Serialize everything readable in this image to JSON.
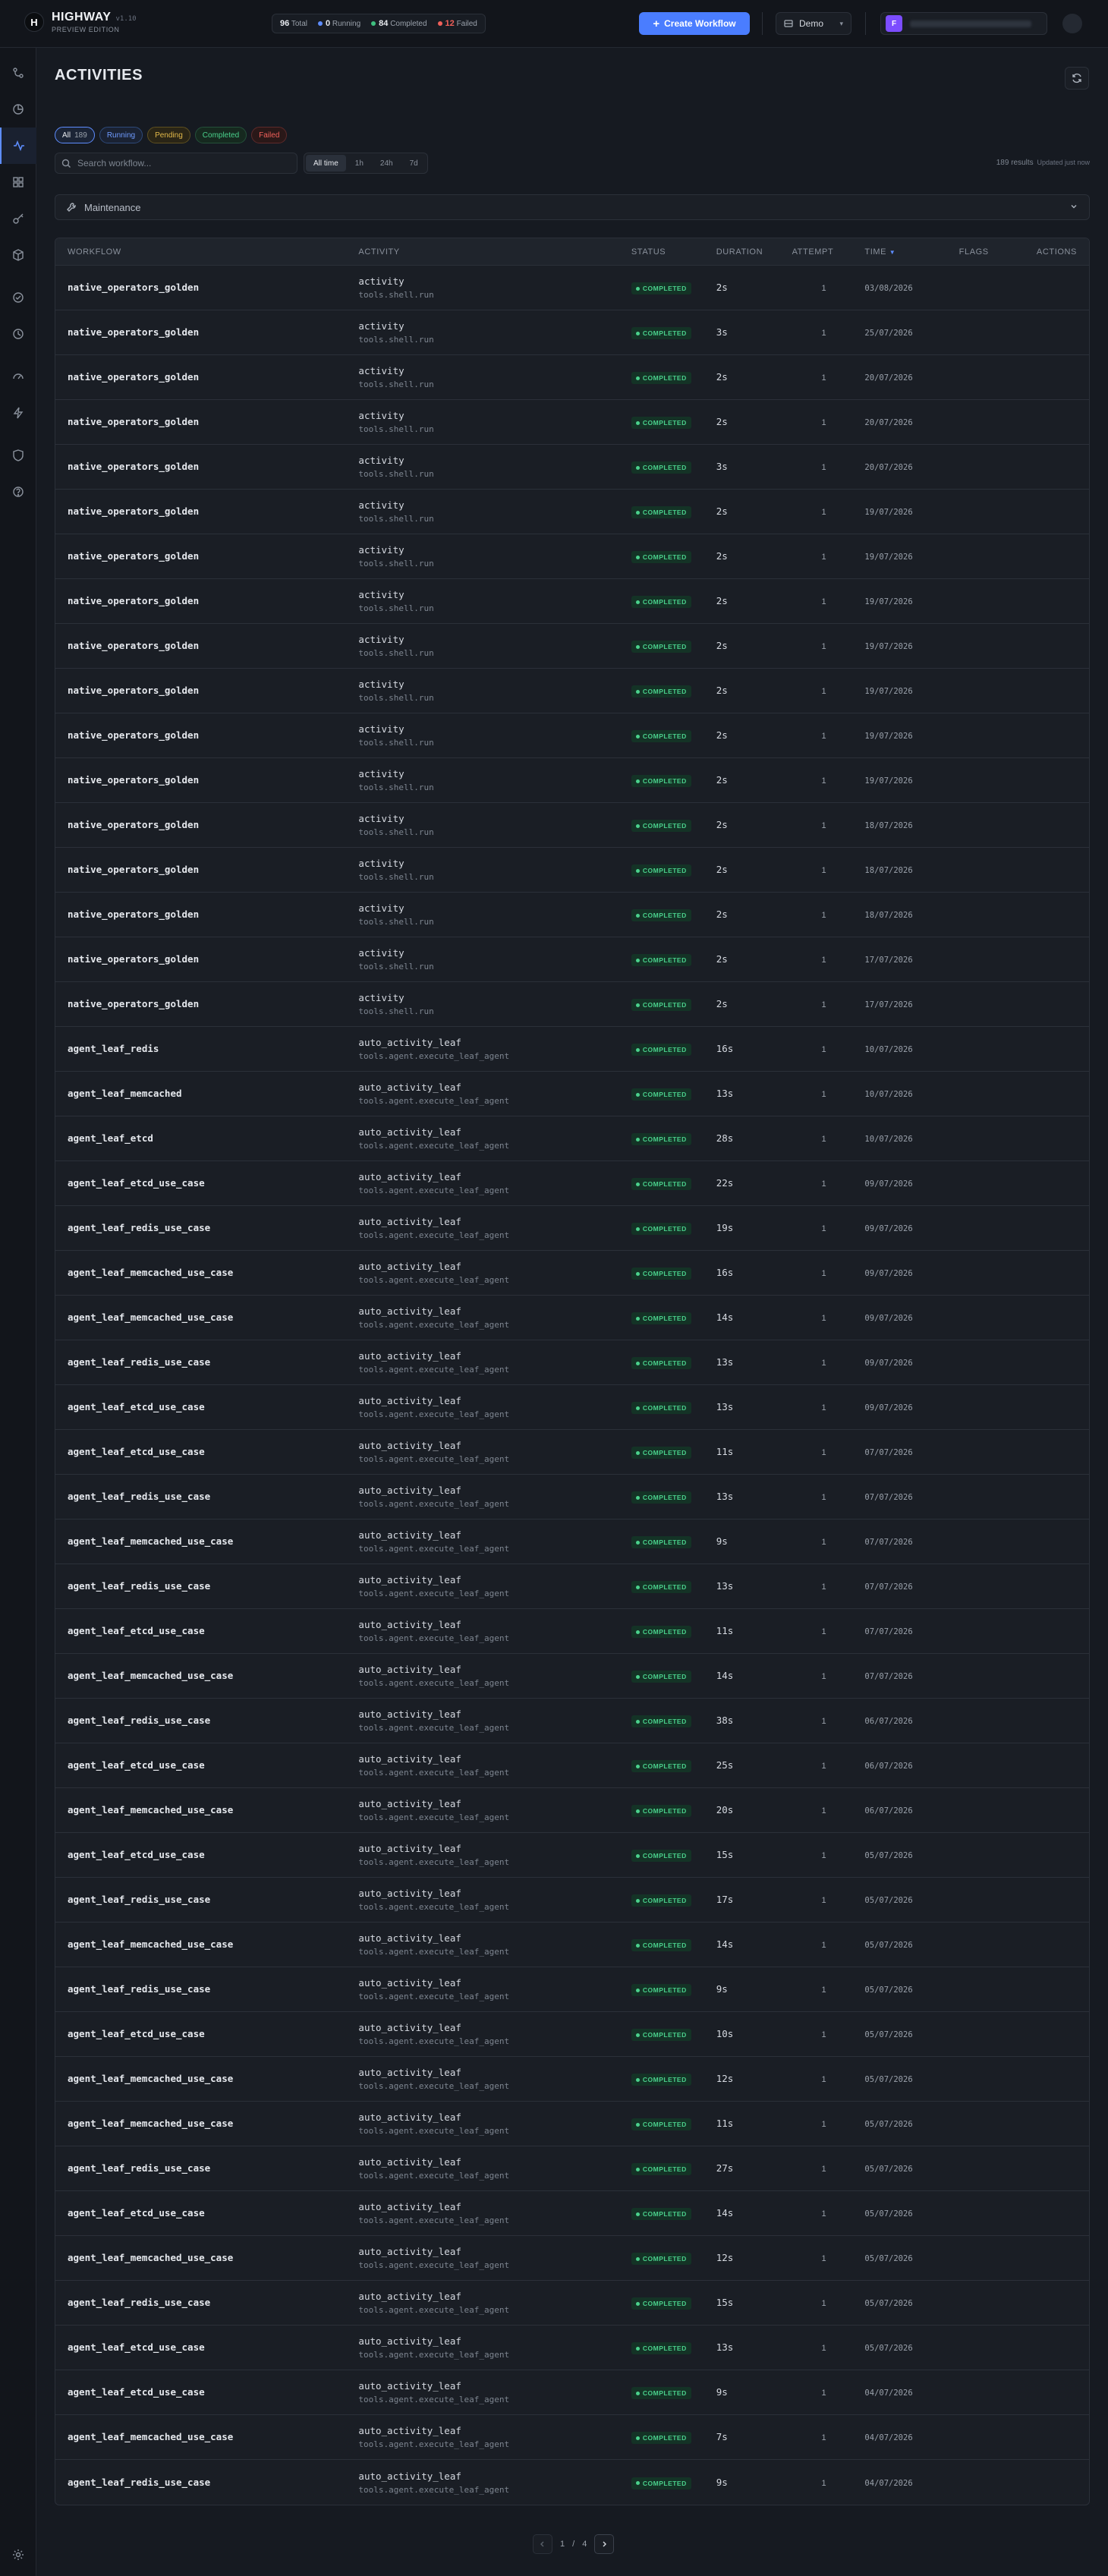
{
  "brand": {
    "logo": "H",
    "name": "HIGHWAY",
    "version": "v1.10",
    "subtitle": "PREVIEW EDITION"
  },
  "stats": {
    "total_value": "96",
    "total_label": "Total",
    "running_value": "0",
    "running_label": "Running",
    "completed_value": "84",
    "completed_label": "Completed",
    "failed_value": "12",
    "failed_label": "Failed",
    "colors": {
      "running": "#5e8dff",
      "completed": "#3fbf7f",
      "failed": "#f0605a"
    }
  },
  "header": {
    "create_label": "Create Workflow",
    "demo_label": "Demo",
    "avatar_letter": "F"
  },
  "page": {
    "title": "ACTIVITIES"
  },
  "filters": {
    "all_label": "All",
    "all_count": "189",
    "running_label": "Running",
    "pending_label": "Pending",
    "completed_label": "Completed",
    "failed_label": "Failed"
  },
  "search": {
    "placeholder": "Search workflow..."
  },
  "range": {
    "all_time": "All time",
    "h1": "1h",
    "h24": "24h",
    "d7": "7d"
  },
  "results": {
    "count_text": "189 results",
    "updated_text": "Updated just now"
  },
  "maintenance": {
    "label": "Maintenance"
  },
  "table": {
    "columns": {
      "workflow": "WORKFLOW",
      "activity": "ACTIVITY",
      "status": "STATUS",
      "duration": "DURATION",
      "attempt": "ATTEMPT",
      "time": "TIME",
      "flags": "FLAGS",
      "actions": "ACTIONS"
    },
    "sort_indicator": "▼",
    "rows": [
      {
        "workflow": "native_operators_golden",
        "activity": "activity",
        "path": "tools.shell.run",
        "status": "COMPLETED",
        "duration": "2s",
        "attempt": "1",
        "time": "03/08/2026"
      },
      {
        "workflow": "native_operators_golden",
        "activity": "activity",
        "path": "tools.shell.run",
        "status": "COMPLETED",
        "duration": "3s",
        "attempt": "1",
        "time": "25/07/2026"
      },
      {
        "workflow": "native_operators_golden",
        "activity": "activity",
        "path": "tools.shell.run",
        "status": "COMPLETED",
        "duration": "2s",
        "attempt": "1",
        "time": "20/07/2026"
      },
      {
        "workflow": "native_operators_golden",
        "activity": "activity",
        "path": "tools.shell.run",
        "status": "COMPLETED",
        "duration": "2s",
        "attempt": "1",
        "time": "20/07/2026"
      },
      {
        "workflow": "native_operators_golden",
        "activity": "activity",
        "path": "tools.shell.run",
        "status": "COMPLETED",
        "duration": "3s",
        "attempt": "1",
        "time": "20/07/2026"
      },
      {
        "workflow": "native_operators_golden",
        "activity": "activity",
        "path": "tools.shell.run",
        "status": "COMPLETED",
        "duration": "2s",
        "attempt": "1",
        "time": "19/07/2026"
      },
      {
        "workflow": "native_operators_golden",
        "activity": "activity",
        "path": "tools.shell.run",
        "status": "COMPLETED",
        "duration": "2s",
        "attempt": "1",
        "time": "19/07/2026"
      },
      {
        "workflow": "native_operators_golden",
        "activity": "activity",
        "path": "tools.shell.run",
        "status": "COMPLETED",
        "duration": "2s",
        "attempt": "1",
        "time": "19/07/2026"
      },
      {
        "workflow": "native_operators_golden",
        "activity": "activity",
        "path": "tools.shell.run",
        "status": "COMPLETED",
        "duration": "2s",
        "attempt": "1",
        "time": "19/07/2026"
      },
      {
        "workflow": "native_operators_golden",
        "activity": "activity",
        "path": "tools.shell.run",
        "status": "COMPLETED",
        "duration": "2s",
        "attempt": "1",
        "time": "19/07/2026"
      },
      {
        "workflow": "native_operators_golden",
        "activity": "activity",
        "path": "tools.shell.run",
        "status": "COMPLETED",
        "duration": "2s",
        "attempt": "1",
        "time": "19/07/2026"
      },
      {
        "workflow": "native_operators_golden",
        "activity": "activity",
        "path": "tools.shell.run",
        "status": "COMPLETED",
        "duration": "2s",
        "attempt": "1",
        "time": "19/07/2026"
      },
      {
        "workflow": "native_operators_golden",
        "activity": "activity",
        "path": "tools.shell.run",
        "status": "COMPLETED",
        "duration": "2s",
        "attempt": "1",
        "time": "18/07/2026"
      },
      {
        "workflow": "native_operators_golden",
        "activity": "activity",
        "path": "tools.shell.run",
        "status": "COMPLETED",
        "duration": "2s",
        "attempt": "1",
        "time": "18/07/2026"
      },
      {
        "workflow": "native_operators_golden",
        "activity": "activity",
        "path": "tools.shell.run",
        "status": "COMPLETED",
        "duration": "2s",
        "attempt": "1",
        "time": "18/07/2026"
      },
      {
        "workflow": "native_operators_golden",
        "activity": "activity",
        "path": "tools.shell.run",
        "status": "COMPLETED",
        "duration": "2s",
        "attempt": "1",
        "time": "17/07/2026"
      },
      {
        "workflow": "native_operators_golden",
        "activity": "activity",
        "path": "tools.shell.run",
        "status": "COMPLETED",
        "duration": "2s",
        "attempt": "1",
        "time": "17/07/2026"
      },
      {
        "workflow": "agent_leaf_redis",
        "activity": "auto_activity_leaf",
        "path": "tools.agent.execute_leaf_agent",
        "status": "COMPLETED",
        "duration": "16s",
        "attempt": "1",
        "time": "10/07/2026"
      },
      {
        "workflow": "agent_leaf_memcached",
        "activity": "auto_activity_leaf",
        "path": "tools.agent.execute_leaf_agent",
        "status": "COMPLETED",
        "duration": "13s",
        "attempt": "1",
        "time": "10/07/2026"
      },
      {
        "workflow": "agent_leaf_etcd",
        "activity": "auto_activity_leaf",
        "path": "tools.agent.execute_leaf_agent",
        "status": "COMPLETED",
        "duration": "28s",
        "attempt": "1",
        "time": "10/07/2026"
      },
      {
        "workflow": "agent_leaf_etcd_use_case",
        "activity": "auto_activity_leaf",
        "path": "tools.agent.execute_leaf_agent",
        "status": "COMPLETED",
        "duration": "22s",
        "attempt": "1",
        "time": "09/07/2026"
      },
      {
        "workflow": "agent_leaf_redis_use_case",
        "activity": "auto_activity_leaf",
        "path": "tools.agent.execute_leaf_agent",
        "status": "COMPLETED",
        "duration": "19s",
        "attempt": "1",
        "time": "09/07/2026"
      },
      {
        "workflow": "agent_leaf_memcached_use_case",
        "activity": "auto_activity_leaf",
        "path": "tools.agent.execute_leaf_agent",
        "status": "COMPLETED",
        "duration": "16s",
        "attempt": "1",
        "time": "09/07/2026"
      },
      {
        "workflow": "agent_leaf_memcached_use_case",
        "activity": "auto_activity_leaf",
        "path": "tools.agent.execute_leaf_agent",
        "status": "COMPLETED",
        "duration": "14s",
        "attempt": "1",
        "time": "09/07/2026"
      },
      {
        "workflow": "agent_leaf_redis_use_case",
        "activity": "auto_activity_leaf",
        "path": "tools.agent.execute_leaf_agent",
        "status": "COMPLETED",
        "duration": "13s",
        "attempt": "1",
        "time": "09/07/2026"
      },
      {
        "workflow": "agent_leaf_etcd_use_case",
        "activity": "auto_activity_leaf",
        "path": "tools.agent.execute_leaf_agent",
        "status": "COMPLETED",
        "duration": "13s",
        "attempt": "1",
        "time": "09/07/2026"
      },
      {
        "workflow": "agent_leaf_etcd_use_case",
        "activity": "auto_activity_leaf",
        "path": "tools.agent.execute_leaf_agent",
        "status": "COMPLETED",
        "duration": "11s",
        "attempt": "1",
        "time": "07/07/2026"
      },
      {
        "workflow": "agent_leaf_redis_use_case",
        "activity": "auto_activity_leaf",
        "path": "tools.agent.execute_leaf_agent",
        "status": "COMPLETED",
        "duration": "13s",
        "attempt": "1",
        "time": "07/07/2026"
      },
      {
        "workflow": "agent_leaf_memcached_use_case",
        "activity": "auto_activity_leaf",
        "path": "tools.agent.execute_leaf_agent",
        "status": "COMPLETED",
        "duration": "9s",
        "attempt": "1",
        "time": "07/07/2026"
      },
      {
        "workflow": "agent_leaf_redis_use_case",
        "activity": "auto_activity_leaf",
        "path": "tools.agent.execute_leaf_agent",
        "status": "COMPLETED",
        "duration": "13s",
        "attempt": "1",
        "time": "07/07/2026"
      },
      {
        "workflow": "agent_leaf_etcd_use_case",
        "activity": "auto_activity_leaf",
        "path": "tools.agent.execute_leaf_agent",
        "status": "COMPLETED",
        "duration": "11s",
        "attempt": "1",
        "time": "07/07/2026"
      },
      {
        "workflow": "agent_leaf_memcached_use_case",
        "activity": "auto_activity_leaf",
        "path": "tools.agent.execute_leaf_agent",
        "status": "COMPLETED",
        "duration": "14s",
        "attempt": "1",
        "time": "07/07/2026"
      },
      {
        "workflow": "agent_leaf_redis_use_case",
        "activity": "auto_activity_leaf",
        "path": "tools.agent.execute_leaf_agent",
        "status": "COMPLETED",
        "duration": "38s",
        "attempt": "1",
        "time": "06/07/2026"
      },
      {
        "workflow": "agent_leaf_etcd_use_case",
        "activity": "auto_activity_leaf",
        "path": "tools.agent.execute_leaf_agent",
        "status": "COMPLETED",
        "duration": "25s",
        "attempt": "1",
        "time": "06/07/2026"
      },
      {
        "workflow": "agent_leaf_memcached_use_case",
        "activity": "auto_activity_leaf",
        "path": "tools.agent.execute_leaf_agent",
        "status": "COMPLETED",
        "duration": "20s",
        "attempt": "1",
        "time": "06/07/2026"
      },
      {
        "workflow": "agent_leaf_etcd_use_case",
        "activity": "auto_activity_leaf",
        "path": "tools.agent.execute_leaf_agent",
        "status": "COMPLETED",
        "duration": "15s",
        "attempt": "1",
        "time": "05/07/2026"
      },
      {
        "workflow": "agent_leaf_redis_use_case",
        "activity": "auto_activity_leaf",
        "path": "tools.agent.execute_leaf_agent",
        "status": "COMPLETED",
        "duration": "17s",
        "attempt": "1",
        "time": "05/07/2026"
      },
      {
        "workflow": "agent_leaf_memcached_use_case",
        "activity": "auto_activity_leaf",
        "path": "tools.agent.execute_leaf_agent",
        "status": "COMPLETED",
        "duration": "14s",
        "attempt": "1",
        "time": "05/07/2026"
      },
      {
        "workflow": "agent_leaf_redis_use_case",
        "activity": "auto_activity_leaf",
        "path": "tools.agent.execute_leaf_agent",
        "status": "COMPLETED",
        "duration": "9s",
        "attempt": "1",
        "time": "05/07/2026"
      },
      {
        "workflow": "agent_leaf_etcd_use_case",
        "activity": "auto_activity_leaf",
        "path": "tools.agent.execute_leaf_agent",
        "status": "COMPLETED",
        "duration": "10s",
        "attempt": "1",
        "time": "05/07/2026"
      },
      {
        "workflow": "agent_leaf_memcached_use_case",
        "activity": "auto_activity_leaf",
        "path": "tools.agent.execute_leaf_agent",
        "status": "COMPLETED",
        "duration": "12s",
        "attempt": "1",
        "time": "05/07/2026"
      },
      {
        "workflow": "agent_leaf_memcached_use_case",
        "activity": "auto_activity_leaf",
        "path": "tools.agent.execute_leaf_agent",
        "status": "COMPLETED",
        "duration": "11s",
        "attempt": "1",
        "time": "05/07/2026"
      },
      {
        "workflow": "agent_leaf_redis_use_case",
        "activity": "auto_activity_leaf",
        "path": "tools.agent.execute_leaf_agent",
        "status": "COMPLETED",
        "duration": "27s",
        "attempt": "1",
        "time": "05/07/2026"
      },
      {
        "workflow": "agent_leaf_etcd_use_case",
        "activity": "auto_activity_leaf",
        "path": "tools.agent.execute_leaf_agent",
        "status": "COMPLETED",
        "duration": "14s",
        "attempt": "1",
        "time": "05/07/2026"
      },
      {
        "workflow": "agent_leaf_memcached_use_case",
        "activity": "auto_activity_leaf",
        "path": "tools.agent.execute_leaf_agent",
        "status": "COMPLETED",
        "duration": "12s",
        "attempt": "1",
        "time": "05/07/2026"
      },
      {
        "workflow": "agent_leaf_redis_use_case",
        "activity": "auto_activity_leaf",
        "path": "tools.agent.execute_leaf_agent",
        "status": "COMPLETED",
        "duration": "15s",
        "attempt": "1",
        "time": "05/07/2026"
      },
      {
        "workflow": "agent_leaf_etcd_use_case",
        "activity": "auto_activity_leaf",
        "path": "tools.agent.execute_leaf_agent",
        "status": "COMPLETED",
        "duration": "13s",
        "attempt": "1",
        "time": "05/07/2026"
      },
      {
        "workflow": "agent_leaf_etcd_use_case",
        "activity": "auto_activity_leaf",
        "path": "tools.agent.execute_leaf_agent",
        "status": "COMPLETED",
        "duration": "9s",
        "attempt": "1",
        "time": "04/07/2026"
      },
      {
        "workflow": "agent_leaf_memcached_use_case",
        "activity": "auto_activity_leaf",
        "path": "tools.agent.execute_leaf_agent",
        "status": "COMPLETED",
        "duration": "7s",
        "attempt": "1",
        "time": "04/07/2026"
      },
      {
        "workflow": "agent_leaf_redis_use_case",
        "activity": "auto_activity_leaf",
        "path": "tools.agent.execute_leaf_agent",
        "status": "COMPLETED",
        "duration": "9s",
        "attempt": "1",
        "time": "04/07/2026"
      }
    ]
  },
  "pagination": {
    "current": "1",
    "separator": "/",
    "total": "4"
  },
  "sidebar": {
    "icons": [
      "workflow-icon",
      "history-icon",
      "activity-icon",
      "dashboard-icon",
      "key-icon",
      "package-icon",
      "check-circle-icon",
      "clock-icon",
      "gauge-icon",
      "zap-icon",
      "shield-icon",
      "help-icon"
    ],
    "active_index": 2
  }
}
